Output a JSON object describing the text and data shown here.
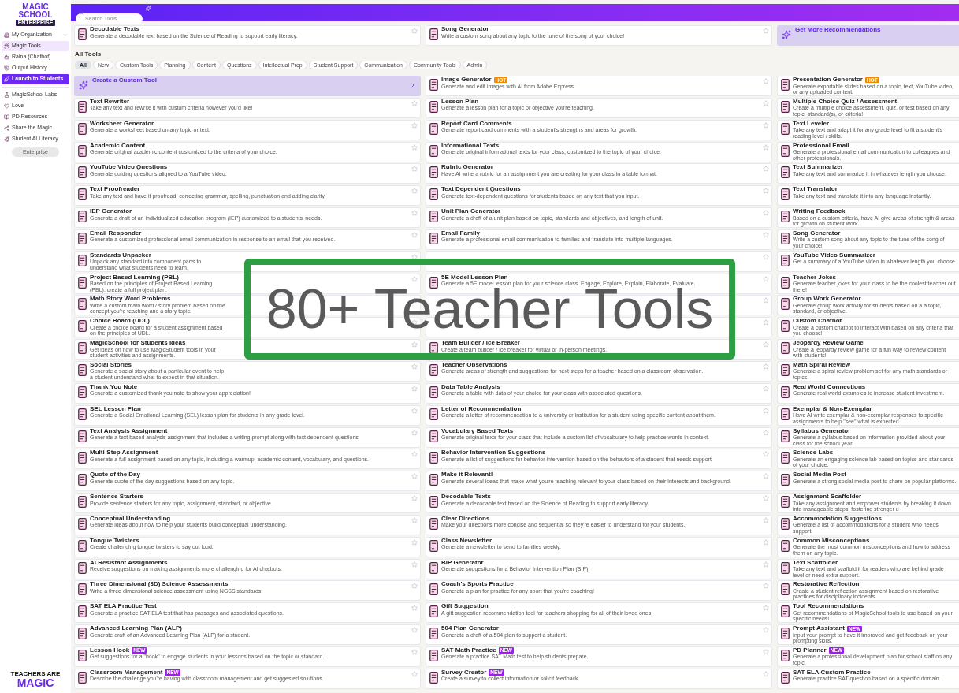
{
  "sidebar": {
    "logo": {
      "line_1": "MAGIC",
      "line_2": "SCHOOL",
      "badge": "ENTERPRISE"
    },
    "items": [
      {
        "kind": "menu",
        "label": "My Organization",
        "selected": false
      },
      {
        "kind": "item",
        "label": "Magic Tools",
        "selected": true
      },
      {
        "kind": "item",
        "label": "Raina (Chatbot)",
        "selected": false
      },
      {
        "kind": "item",
        "label": "Output History",
        "selected": false
      },
      {
        "kind": "button",
        "label": "Launch to Students"
      },
      {
        "kind": "divider"
      },
      {
        "kind": "item",
        "label": "MagicSchool Labs",
        "selected": false
      },
      {
        "kind": "item",
        "label": "Love",
        "selected": false
      },
      {
        "kind": "item",
        "label": "PD Resources",
        "selected": false
      },
      {
        "kind": "item",
        "label": "Share the Magic",
        "selected": false
      },
      {
        "kind": "item",
        "label": "Student AI Literacy",
        "selected": false
      },
      {
        "kind": "pill",
        "label": "Enterprise"
      }
    ],
    "footer_logo": {
      "line_1": "TEACHERS ARE",
      "line_2": "MAGIC"
    }
  },
  "search": {
    "placeholder": "Search Tools"
  },
  "recommendations": [
    {
      "kind": "tool",
      "title": "Decodable Texts",
      "description": "Generate a decodable text based on the Science of Reading to support early literacy.",
      "starred": false
    },
    {
      "kind": "tool",
      "title": "Song Generator",
      "description": "Write a custom song about any topic to the tune of the song of your choice!",
      "starred": false
    },
    {
      "kind": "recommend",
      "title": "Get More Recommendations"
    }
  ],
  "all_tools_heading": "All Tools",
  "filters": [
    {
      "label": "All",
      "selected": true
    },
    {
      "label": "New",
      "selected": false
    },
    {
      "label": "Custom Tools",
      "selected": false
    },
    {
      "label": "Planning",
      "selected": false
    },
    {
      "label": "Content",
      "selected": false
    },
    {
      "label": "Questions",
      "selected": false
    },
    {
      "label": "Intellectual Prep",
      "selected": false
    },
    {
      "label": "Student Support",
      "selected": false
    },
    {
      "label": "Communication",
      "selected": false
    },
    {
      "label": "Community Tools",
      "selected": false
    },
    {
      "label": "Admin",
      "selected": false
    }
  ],
  "tools": [
    {
      "kind": "custom",
      "title": "Create a Custom Tool"
    },
    {
      "kind": "tool",
      "title": "Image Generator",
      "badge": {
        "kind": "hot",
        "label": "HOT"
      },
      "description": "Generate and edit images with AI from Adobe Express.",
      "starred": false
    },
    {
      "kind": "tool",
      "title": "Presentation Generator",
      "badge": {
        "kind": "hot",
        "label": "HOT"
      },
      "description": "Generate exportable slides based on a topic, text, YouTube video, or any uploaded content."
    },
    {
      "kind": "tool",
      "title": "Text Rewriter",
      "description": "Take any text and rewrite it with custom criteria however you'd like!",
      "starred": false
    },
    {
      "kind": "tool",
      "title": "Lesson Plan",
      "description": "Generate a lesson plan for a topic or objective you're teaching.",
      "starred": false
    },
    {
      "kind": "tool",
      "title": "Multiple Choice Quiz / Assessment",
      "description": "Create a multiple choice assessment, quiz, or test based on any topic, standard(s), or criteria!"
    },
    {
      "kind": "tool",
      "title": "Worksheet Generator",
      "description": "Generate a worksheet based on any topic or text.",
      "starred": false
    },
    {
      "kind": "tool",
      "title": "Report Card Comments",
      "description": "Generate report card comments with a student's strengths and areas for growth.",
      "starred": false
    },
    {
      "kind": "tool",
      "title": "Text Leveler",
      "description": "Take any text and adapt it for any grade level to fit a student's reading level / skills."
    },
    {
      "kind": "tool",
      "title": "Academic Content",
      "description": "Generate original academic content customized to the criteria of your choice.",
      "starred": false
    },
    {
      "kind": "tool",
      "title": "Informational Texts",
      "description": "Generate original informational texts for your class, customized to the topic of your choice.",
      "starred": false
    },
    {
      "kind": "tool",
      "title": "Professional Email",
      "description": "Generate a professional email communication to colleagues and other professionals."
    },
    {
      "kind": "tool",
      "title": "YouTube Video Questions",
      "description": "Generate guiding questions aligned to a YouTube video.",
      "starred": false
    },
    {
      "kind": "tool",
      "title": "Rubric Generator",
      "description": "Have AI write a rubric for an assignment you are creating for your class in a table format.",
      "starred": false
    },
    {
      "kind": "tool",
      "title": "Text Summarizer",
      "description": "Take any text and summarize it in whatever length you choose."
    },
    {
      "kind": "tool",
      "title": "Text Proofreader",
      "description": "Take any text and have it proofread, correcting grammar, spelling, punctuation and adding clarity.",
      "starred": false
    },
    {
      "kind": "tool",
      "title": "Text Dependent Questions",
      "description": "Generate text-dependent questions for students based on any text that you input.",
      "starred": false
    },
    {
      "kind": "tool",
      "title": "Text Translator",
      "description": "Take any text and translate it into any language instantly."
    },
    {
      "kind": "tool",
      "title": "IEP Generator",
      "description": "Generate a draft of an individualized education program (IEP) customized to a students' needs.",
      "starred": false
    },
    {
      "kind": "tool",
      "title": "Unit Plan Generator",
      "description": "Generate a draft of a unit plan based on topic, standards and objectives, and length of unit.",
      "starred": false
    },
    {
      "kind": "tool",
      "title": "Writing Feedback",
      "description": "Based on a custom criteria, have AI give areas of strength & areas for growth on student work."
    },
    {
      "kind": "tool",
      "title": "Email Responder",
      "description": "Generate a customized professional email communication in response to an email that you received.",
      "starred": false
    },
    {
      "kind": "tool",
      "title": "Email Family",
      "description": "Generate a professional email communication to families and translate into multiple languages.",
      "starred": false
    },
    {
      "kind": "tool",
      "title": "Song Generator",
      "description": "Write a custom song about any topic to the tune of the song of your choice!"
    },
    {
      "kind": "tool",
      "title": "Standards Unpacker",
      "description": "Unpack any standard into component parts to understand what students need to learn.",
      "starred": false
    },
    {
      "kind": "tool",
      "starred": false
    },
    {
      "kind": "tool",
      "title": "YouTube Video Summarizer",
      "description": "Get a summary of a YouTube video in whatever length you choose."
    },
    {
      "kind": "tool",
      "title": "Project Based Learning (PBL)",
      "description": "Based on the principles of Project Based Learning (PBL), create a full project plan.",
      "starred": false
    },
    {
      "kind": "tool",
      "title": "5E Model Lesson Plan",
      "description": "Generate a 5E model lesson plan for your science class. Engage, Explore, Explain, Elaborate, Evaluate.",
      "starred": false
    },
    {
      "kind": "tool",
      "title": "Teacher Jokes",
      "description": "Generate teacher jokes for your class to be the coolest teacher out there!"
    },
    {
      "kind": "tool",
      "title": "Math Story Word Problems",
      "description": "Write a custom math word / story problem based on the concept you're teaching and a story topic.",
      "starred": false
    },
    {
      "kind": "tool",
      "starred": false
    },
    {
      "kind": "tool",
      "title": "Group Work Generator",
      "description": "Generate group work activity for students based on a a topic, standard, or objective."
    },
    {
      "kind": "tool",
      "title": "Choice Board (UDL)",
      "description": "Create a choice board for a student assignment based on the principles of UDL.",
      "starred": false
    },
    {
      "kind": "tool",
      "starred": false
    },
    {
      "kind": "tool",
      "title": "Custom Chatbot",
      "description": "Create a custom chatbot to interact with based on any criteria that you choose!"
    },
    {
      "kind": "tool",
      "title": "MagicSchool for Students Ideas",
      "description": "Get ideas on how to use MagicStudent tools in your student activities and assignments.",
      "starred": false
    },
    {
      "kind": "tool",
      "title": "Team Builder / Ice Breaker",
      "description": "Create a team builder / ice breaker for virtual or in-person meetings.",
      "starred": false
    },
    {
      "kind": "tool",
      "title": "Jeopardy Review Game",
      "description": "Create a jeopardy review game for a fun way to review content with students!"
    },
    {
      "kind": "tool",
      "title": "Social Stories",
      "description": "Generate a social story about a particular event to help a student understand what to expect in that situation.",
      "starred": false
    },
    {
      "kind": "tool",
      "title": "Teacher Observations",
      "description": "Generate areas of strength and suggestions for next steps for a teacher based on a classroom observation.",
      "starred": false
    },
    {
      "kind": "tool",
      "title": "Math Spiral Review",
      "description": "Generate a spiral review problem set for any math standards or topics."
    },
    {
      "kind": "tool",
      "title": "Thank You Note",
      "description": "Generate a customized thank you note to show your appreciation!",
      "starred": false
    },
    {
      "kind": "tool",
      "title": "Data Table Analysis",
      "description": "Generate a table with data of your choice for your class with associated questions.",
      "starred": false
    },
    {
      "kind": "tool",
      "title": "Real World Connections",
      "description": "Generate real world examples to increase student investment."
    },
    {
      "kind": "tool",
      "title": "SEL Lesson Plan",
      "description": "Generate a Social Emotional Learning (SEL) lesson plan for students in any grade level.",
      "starred": false
    },
    {
      "kind": "tool",
      "title": "Letter of Recommendation",
      "description": "Generate a letter of recommendation to a university or institution for a student using specific content about them.",
      "starred": false
    },
    {
      "kind": "tool",
      "title": "Exemplar & Non-Exemplar",
      "description": "Have AI write exemplar & non-exemplar responses to specific assignments to help \"see\" what is expected."
    },
    {
      "kind": "tool",
      "title": "Text Analysis Assignment",
      "description": "Generate a text based analysis assignment that includes a writing prompt along with text dependent questions.",
      "starred": false
    },
    {
      "kind": "tool",
      "title": "Vocabulary Based Texts",
      "description": "Generate original texts for your class that include a custom list of vocabulary to help practice words in context.",
      "starred": false
    },
    {
      "kind": "tool",
      "title": "Syllabus Generator",
      "description": "Generate a syllabus based on information provided about your class for the school year."
    },
    {
      "kind": "tool",
      "title": "Multi-Step Assignment",
      "description": "Generate a full assignment based on any topic, including a warmup, academic content, vocabulary, and questions.",
      "starred": false
    },
    {
      "kind": "tool",
      "title": "Behavior Intervention Suggestions",
      "description": "Generate a list of suggestions for behavior intervention based on the behaviors of a student that needs support.",
      "starred": false
    },
    {
      "kind": "tool",
      "title": "Science Labs",
      "description": "Generate an engaging science lab based on topics and standards of your choice."
    },
    {
      "kind": "tool",
      "title": "Quote of the Day",
      "description": "Generate quote of the day suggestions based on any topic.",
      "starred": false
    },
    {
      "kind": "tool",
      "title": "Make it Relevant!",
      "description": "Generate several ideas that make what you're teaching relevant to your class based on their interests and background.",
      "starred": false
    },
    {
      "kind": "tool",
      "title": "Social Media Post",
      "description": "Generate a strong social media post to share on popular platforms."
    },
    {
      "kind": "tool",
      "title": "Sentence Starters",
      "description": "Provide sentence starters for any topic, assignment, standard, or objective.",
      "starred": false
    },
    {
      "kind": "tool",
      "title": "Decodable Texts",
      "description": "Generate a decodable text based on the Science of Reading to support early literacy.",
      "starred": false
    },
    {
      "kind": "tool",
      "title": "Assignment Scaffolder",
      "description": "Take any assignment and empower students by breaking it down into manageable steps, fostering stronger u"
    },
    {
      "kind": "tool",
      "title": "Conceptual Understanding",
      "description": "Generate ideas about how to help your students build conceptual understanding.",
      "starred": false
    },
    {
      "kind": "tool",
      "title": "Clear Directions",
      "description": "Make your directions more concise and sequential so they're easier to understand for your students.",
      "starred": false
    },
    {
      "kind": "tool",
      "title": "Accommodation Suggestions",
      "description": "Generate a list of accommodations for a student who needs support."
    },
    {
      "kind": "tool",
      "title": "Tongue Twisters",
      "description": "Create challenging tongue twisters to say out loud.",
      "starred": false
    },
    {
      "kind": "tool",
      "title": "Class Newsletter",
      "description": "Generate a newsletter to send to families weekly.",
      "starred": false
    },
    {
      "kind": "tool",
      "title": "Common Misconceptions",
      "description": "Generate the most common misconceptions and how to address them on any topic."
    },
    {
      "kind": "tool",
      "title": "AI Resistant Assignments",
      "description": "Receive suggestions on making assignments more challenging for AI chatbots.",
      "starred": false
    },
    {
      "kind": "tool",
      "title": "BIP Generator",
      "description": "Generate suggestions for a Behavior Intervention Plan (BIP).",
      "starred": false
    },
    {
      "kind": "tool",
      "title": "Text Scaffolder",
      "description": "Take any text and scaffold it for readers who are behind grade level or need extra support."
    },
    {
      "kind": "tool",
      "title": "Three Dimensional (3D) Science Assessments",
      "description": "Write a three dimensional science assessment using NGSS standards.",
      "starred": false
    },
    {
      "kind": "tool",
      "title": "Coach's Sports Practice",
      "description": "Generate a plan for practice for any sport that you're coaching!",
      "starred": false
    },
    {
      "kind": "tool",
      "title": "Restorative Reflection",
      "description": "Create a student reflection assignment based on restorative practices for disciplinary incidents."
    },
    {
      "kind": "tool",
      "title": "SAT ELA Practice Test",
      "description": "Generate a practice SAT ELA test that has passages and associated questions.",
      "starred": false
    },
    {
      "kind": "tool",
      "title": "Gift Suggestion",
      "description": "A gift suggestion recommendation tool for teachers shopping for all of their loved ones.",
      "starred": false
    },
    {
      "kind": "tool",
      "title": "Tool Recommendations",
      "description": "Get recommendations of MagicSchool tools to use based on your specific needs!"
    },
    {
      "kind": "tool",
      "title": "Advanced Learning Plan (ALP)",
      "description": "Generate draft of an Advanced Learning Plan (ALP) for a student.",
      "starred": false
    },
    {
      "kind": "tool",
      "title": "504 Plan Generator",
      "description": "Generate a draft of a 504 plan to support a student.",
      "starred": false
    },
    {
      "kind": "tool",
      "title": "Prompt Assistant",
      "badge": {
        "kind": "new",
        "label": "NEW"
      },
      "description": "Input your prompt to have it improved and get feedback on your prompting skills."
    },
    {
      "kind": "tool",
      "title": "Lesson Hook",
      "badge": {
        "kind": "new",
        "label": "NEW"
      },
      "description": "Get suggestions for a \"hook\" to engage students in your lessons based on the topic or standard.",
      "starred": false
    },
    {
      "kind": "tool",
      "title": "SAT Math Practice",
      "badge": {
        "kind": "new",
        "label": "NEW"
      },
      "description": "Generate a practice SAT Math test to help students prepare.",
      "starred": false
    },
    {
      "kind": "tool",
      "title": "PD Planner",
      "badge": {
        "kind": "new",
        "label": "NEW"
      },
      "description": "Generate a professional development plan for school staff on any topic."
    },
    {
      "kind": "tool",
      "title": "Classroom Management",
      "badge": {
        "kind": "new",
        "label": "NEW"
      },
      "description": "Describe the challenge you're having with classroom management and get suggested solutions.",
      "starred": false
    },
    {
      "kind": "tool",
      "title": "Survey Creator",
      "badge": {
        "kind": "new",
        "label": "NEW"
      },
      "description": "Create a survey to collect information or solicit feedback.",
      "starred": false
    },
    {
      "kind": "tool",
      "title": "SAT ELA Custom Practice",
      "description": "Generate practice SAT question based on a specific domain."
    }
  ],
  "banner": {
    "text": "80+ Teacher Tools"
  }
}
